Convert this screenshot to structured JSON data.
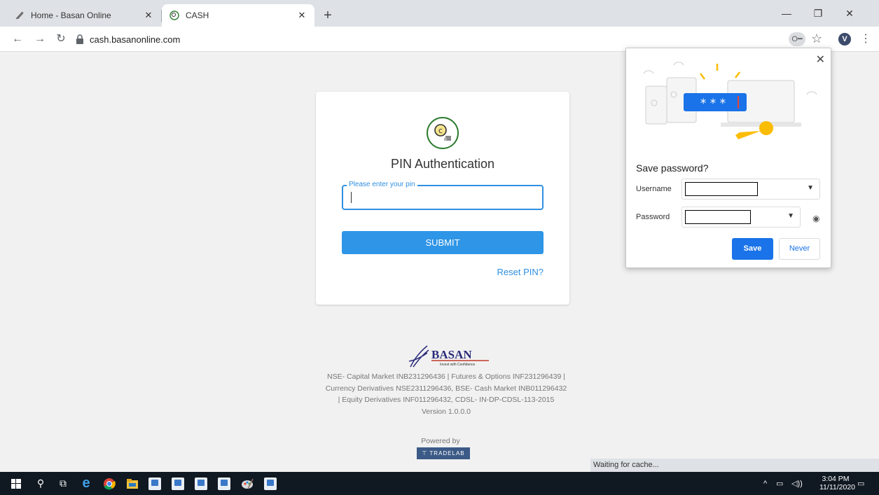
{
  "browser": {
    "tabs": [
      {
        "title": "Home - Basan Online",
        "active": false
      },
      {
        "title": "CASH",
        "active": true
      }
    ],
    "url": "cash.basanonline.com",
    "profile_initial": "V",
    "status_text": "Waiting for cache..."
  },
  "card": {
    "title": "PIN Authentication",
    "pin_placeholder": "Please enter your pin",
    "pin_value": "",
    "submit_label": "SUBMIT",
    "reset_label": "Reset PIN?"
  },
  "footer": {
    "brand": "BASAN",
    "tagline": "Invest with Confidence",
    "lines": [
      "NSE- Capital Market INB231296436 | Futures & Options INF231296439 |",
      "Currency Derivatives NSE2311296436, BSE- Cash Market INB011296432",
      "| Equity Derivatives INF011296432, CDSL- IN-DP-CDSL-113-2015",
      "Version 1.0.0.0"
    ],
    "powered_by": "Powered by",
    "vendor": "TRADELAB"
  },
  "save_password": {
    "title": "Save password?",
    "username_label": "Username",
    "password_label": "Password",
    "illustration_text": "* * *",
    "save_label": "Save",
    "never_label": "Never"
  },
  "taskbar": {
    "time": "3:04 PM",
    "date": "11/11/2020",
    "app_labels": [
      "NSE",
      "BSE",
      "KRA",
      "CDSL",
      "MCX"
    ]
  },
  "colors": {
    "primary": "#2f95e6",
    "chrome_blue": "#1a73e8",
    "taskbar": "#101822"
  }
}
